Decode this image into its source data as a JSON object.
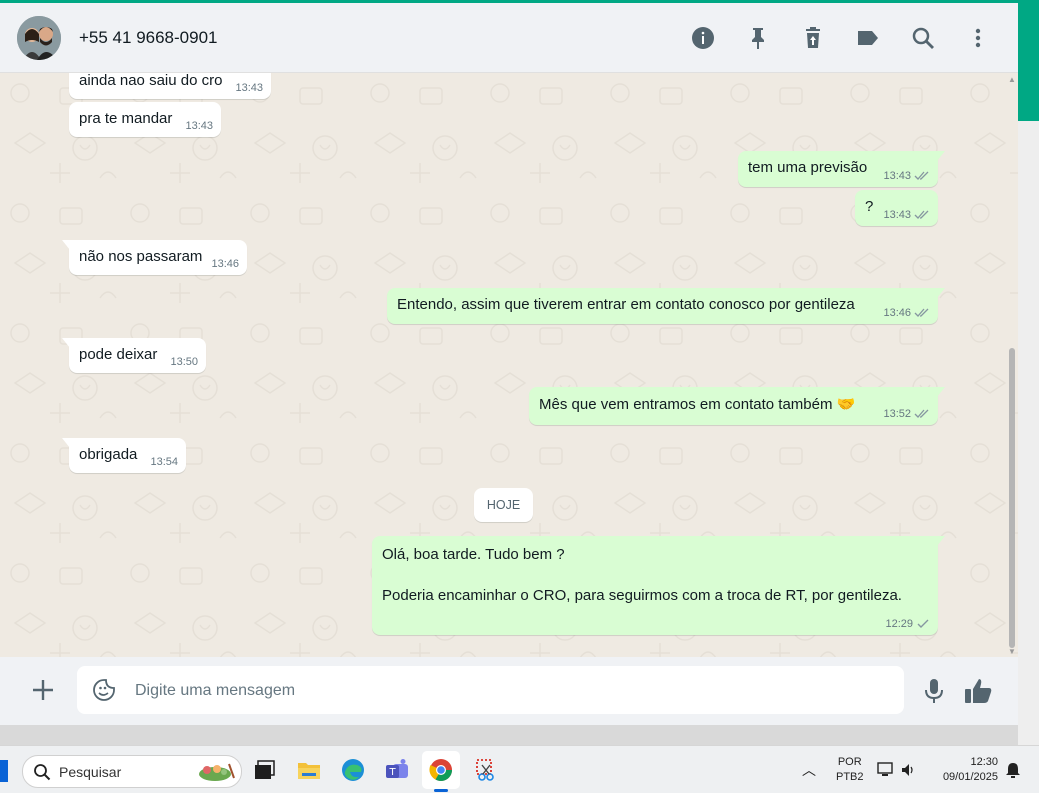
{
  "header": {
    "contact_name": "+55 41 9668-0901"
  },
  "messages": [
    {
      "dir": "in",
      "text": "ainda nao saiu do cro",
      "time": "13:43"
    },
    {
      "dir": "in",
      "text": "pra te mandar",
      "time": "13:43"
    },
    {
      "dir": "out",
      "text": "tem uma previsão",
      "time": "13:43",
      "status": "read"
    },
    {
      "dir": "out",
      "text": "?",
      "time": "13:43",
      "status": "read"
    },
    {
      "dir": "in",
      "text": "não nos passaram",
      "time": "13:46"
    },
    {
      "dir": "out",
      "text": "Entendo, assim que tiverem entrar em contato conosco por gentileza",
      "time": "13:46",
      "status": "read"
    },
    {
      "dir": "in",
      "text": "pode deixar",
      "time": "13:50"
    },
    {
      "dir": "out",
      "text": "Mês que vem entramos em contato também 🤝",
      "time": "13:52",
      "status": "read"
    },
    {
      "dir": "in",
      "text": "obrigada",
      "time": "13:54"
    },
    {
      "dir": "out",
      "text_line1": "Olá, boa tarde. Tudo bem ?",
      "text_line2": "Poderia encaminhar o CRO, para seguirmos com a troca de RT, por gentileza.",
      "time": "12:29",
      "status": "sent"
    }
  ],
  "day_divider": "HOJE",
  "composer": {
    "placeholder": "Digite uma mensagem"
  },
  "taskbar": {
    "search_label": "Pesquisar",
    "lang_line1": "POR",
    "lang_line2": "PTB2",
    "time": "12:30",
    "date": "09/01/2025"
  },
  "colors": {
    "accent": "#00a884",
    "outgoing_bubble": "#d9fdd3",
    "incoming_bubble": "#ffffff",
    "chat_bg": "#efeae2",
    "read_tick": "#53bdeb"
  },
  "icons": {
    "header": [
      "info-icon",
      "pin-icon",
      "delete-icon",
      "label-icon",
      "search-icon",
      "menu-icon"
    ],
    "composer": [
      "plus-icon",
      "sticker-icon",
      "mic-icon",
      "thumbs-up-icon"
    ]
  }
}
